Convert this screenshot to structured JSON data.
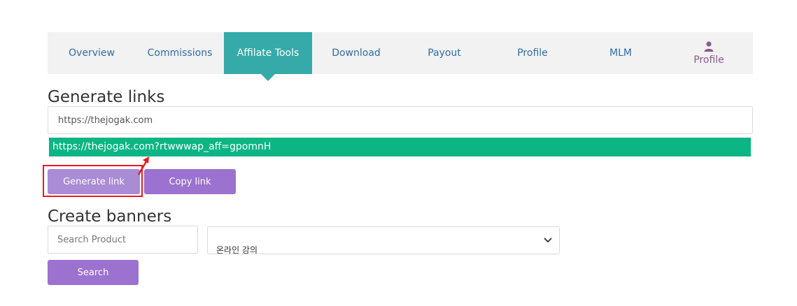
{
  "tabs": [
    {
      "label": "Overview"
    },
    {
      "label": "Commissions"
    },
    {
      "label": "Affilate Tools"
    },
    {
      "label": "Download"
    },
    {
      "label": "Payout"
    },
    {
      "label": "Profile"
    },
    {
      "label": "MLM"
    },
    {
      "label": "Profile",
      "icon": "user-icon"
    }
  ],
  "active_tab": "Affilate Tools",
  "generate": {
    "heading": "Generate links",
    "url_value": "https://thejogak.com",
    "generated_link": "https://thejogak.com?rtwwwap_aff=gpomnH",
    "generate_button": "Generate link",
    "copy_button": "Copy link"
  },
  "banners": {
    "heading": "Create banners",
    "search_placeholder": "Search Product",
    "select_value": "온라인 강의",
    "search_button": "Search"
  },
  "colors": {
    "accent": "#35aaa9",
    "success": "#0bb584",
    "button": "#9b72d0",
    "annotation": "#e8191e"
  }
}
